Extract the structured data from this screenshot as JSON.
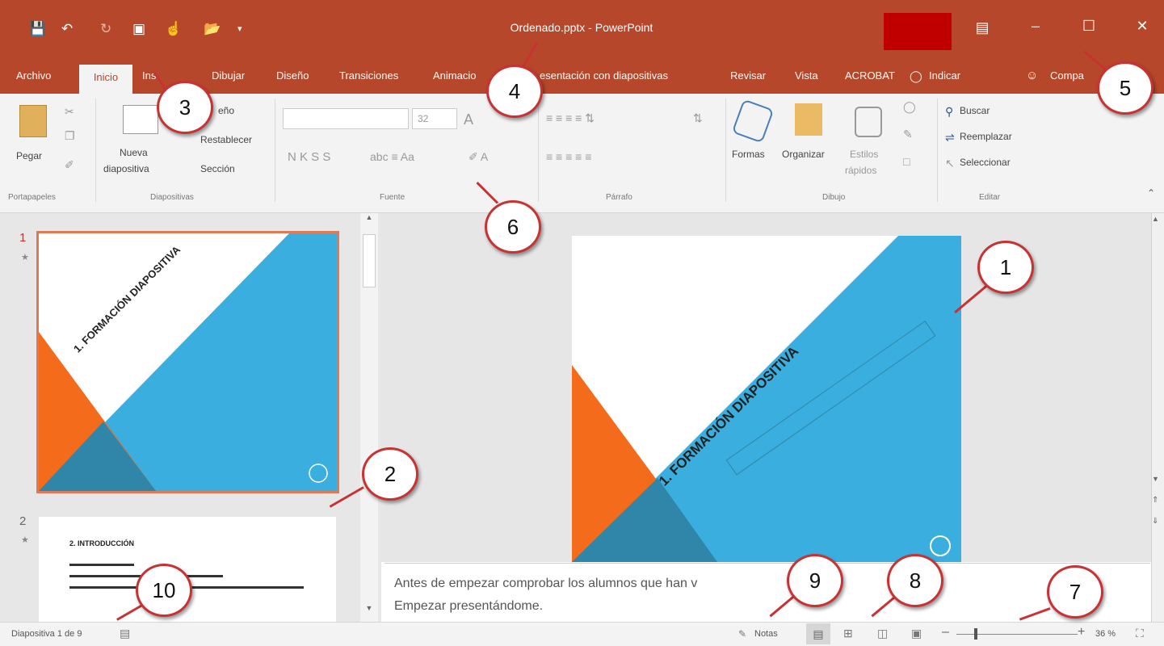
{
  "window": {
    "title": "Ordenado.pptx  -  PowerPoint"
  },
  "qat": {
    "save_icon": "save-icon",
    "undo_icon": "undo-icon",
    "redo_icon": "redo-icon",
    "present_icon": "present-icon",
    "touch_icon": "touch-mode-icon",
    "open_icon": "open-icon",
    "customize_icon": "customize-icon"
  },
  "tabs": {
    "archivo": "Archivo",
    "inicio": "Inicio",
    "insertar": "Ins",
    "dibujar": "Dibujar",
    "diseno": "Diseño",
    "transiciones": "Transiciones",
    "animaciones": "Animacio",
    "presentacion": "esentación con diapositivas",
    "revisar": "Revisar",
    "vista": "Vista",
    "acrobat": "ACROBAT",
    "indicar": "Indicar",
    "compartir": "Compa"
  },
  "ribbon": {
    "pegar": "Pegar",
    "nueva_1": "Nueva",
    "nueva_2": "diapositiva",
    "diseno_btn": "eño",
    "restablecer": "Restablecer",
    "seccion": "Sección",
    "font_size": "32",
    "font_btns": "N  K  S  S",
    "formas": "Formas",
    "organizar": "Organizar",
    "estilos_1": "Estilos",
    "estilos_2": "rápidos",
    "buscar": "Buscar",
    "reemplazar": "Reemplazar",
    "seleccionar": "Seleccionar",
    "groups": {
      "portapapeles": "Portapapeles",
      "diapositivas": "Diapositivas",
      "fuente": "Fuente",
      "parrafo": "Párrafo",
      "dibujo": "Dibujo",
      "editar": "Editar"
    }
  },
  "thumbnails": {
    "slide1_num": "1",
    "slide1_title": "1. FORMACIÓN DIAPOSITIVA",
    "slide2_num": "2",
    "slide2_title": "2. INTRODUCCIÓN"
  },
  "slide": {
    "title": "1. FORMACIÓN DIAPOSITIVA"
  },
  "notes": {
    "line1": "Antes de empezar comprobar los alumnos que han v",
    "line2": "Empezar presentándome."
  },
  "status": {
    "slide_info": "Diapositiva 1 de 9",
    "notas": "Notas",
    "zoom": "36 %"
  },
  "callouts": [
    "1",
    "2",
    "3",
    "4",
    "5",
    "6",
    "7",
    "8",
    "9",
    "10"
  ],
  "colors": {
    "accent": "#b7472a",
    "slide_blue": "#3aaedf",
    "slide_orange": "#f46b1c",
    "callout_border": "#c83232"
  }
}
